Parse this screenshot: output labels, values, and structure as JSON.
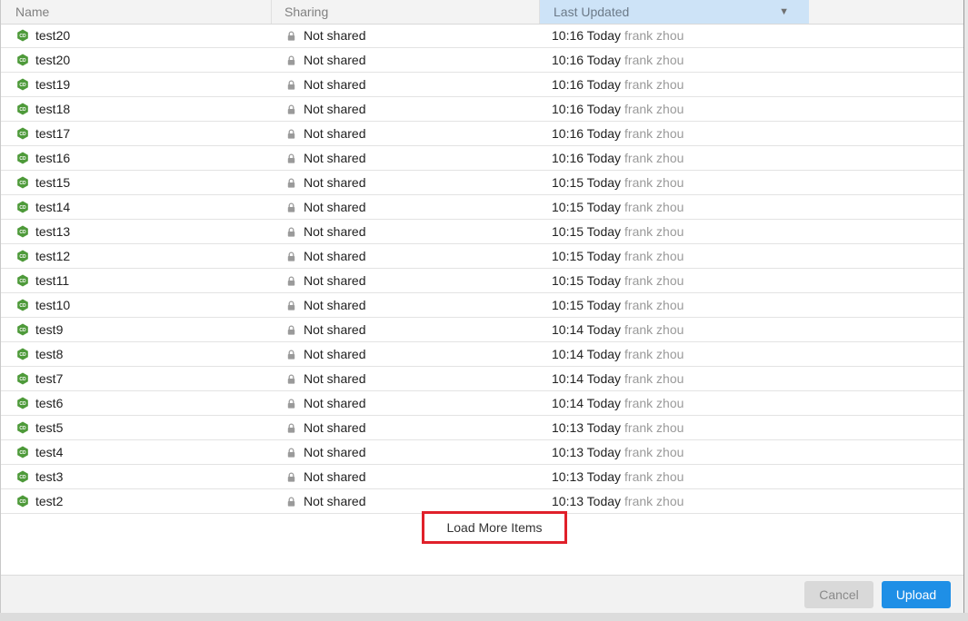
{
  "columns": {
    "name": "Name",
    "sharing": "Sharing",
    "last_updated": "Last Updated"
  },
  "sort_icon": "sort-descending-icon",
  "rows": [
    {
      "name": "test20",
      "sharing": "Not shared",
      "time": "10:16 Today",
      "user": "frank zhou"
    },
    {
      "name": "test20",
      "sharing": "Not shared",
      "time": "10:16 Today",
      "user": "frank zhou"
    },
    {
      "name": "test19",
      "sharing": "Not shared",
      "time": "10:16 Today",
      "user": "frank zhou"
    },
    {
      "name": "test18",
      "sharing": "Not shared",
      "time": "10:16 Today",
      "user": "frank zhou"
    },
    {
      "name": "test17",
      "sharing": "Not shared",
      "time": "10:16 Today",
      "user": "frank zhou"
    },
    {
      "name": "test16",
      "sharing": "Not shared",
      "time": "10:16 Today",
      "user": "frank zhou"
    },
    {
      "name": "test15",
      "sharing": "Not shared",
      "time": "10:15 Today",
      "user": "frank zhou"
    },
    {
      "name": "test14",
      "sharing": "Not shared",
      "time": "10:15 Today",
      "user": "frank zhou"
    },
    {
      "name": "test13",
      "sharing": "Not shared",
      "time": "10:15 Today",
      "user": "frank zhou"
    },
    {
      "name": "test12",
      "sharing": "Not shared",
      "time": "10:15 Today",
      "user": "frank zhou"
    },
    {
      "name": "test11",
      "sharing": "Not shared",
      "time": "10:15 Today",
      "user": "frank zhou"
    },
    {
      "name": "test10",
      "sharing": "Not shared",
      "time": "10:15 Today",
      "user": "frank zhou"
    },
    {
      "name": "test9",
      "sharing": "Not shared",
      "time": "10:14 Today",
      "user": "frank zhou"
    },
    {
      "name": "test8",
      "sharing": "Not shared",
      "time": "10:14 Today",
      "user": "frank zhou"
    },
    {
      "name": "test7",
      "sharing": "Not shared",
      "time": "10:14 Today",
      "user": "frank zhou"
    },
    {
      "name": "test6",
      "sharing": "Not shared",
      "time": "10:14 Today",
      "user": "frank zhou"
    },
    {
      "name": "test5",
      "sharing": "Not shared",
      "time": "10:13 Today",
      "user": "frank zhou"
    },
    {
      "name": "test4",
      "sharing": "Not shared",
      "time": "10:13 Today",
      "user": "frank zhou"
    },
    {
      "name": "test3",
      "sharing": "Not shared",
      "time": "10:13 Today",
      "user": "frank zhou"
    },
    {
      "name": "test2",
      "sharing": "Not shared",
      "time": "10:13 Today",
      "user": "frank zhou"
    }
  ],
  "load_more_label": "Load More Items",
  "buttons": {
    "cancel": "Cancel",
    "upload": "Upload"
  },
  "colors": {
    "file_icon": "#4e9a3a",
    "header_sorted": "#cde3f7",
    "upload_button": "#1f8fe6",
    "highlight_border": "#e0202a"
  }
}
